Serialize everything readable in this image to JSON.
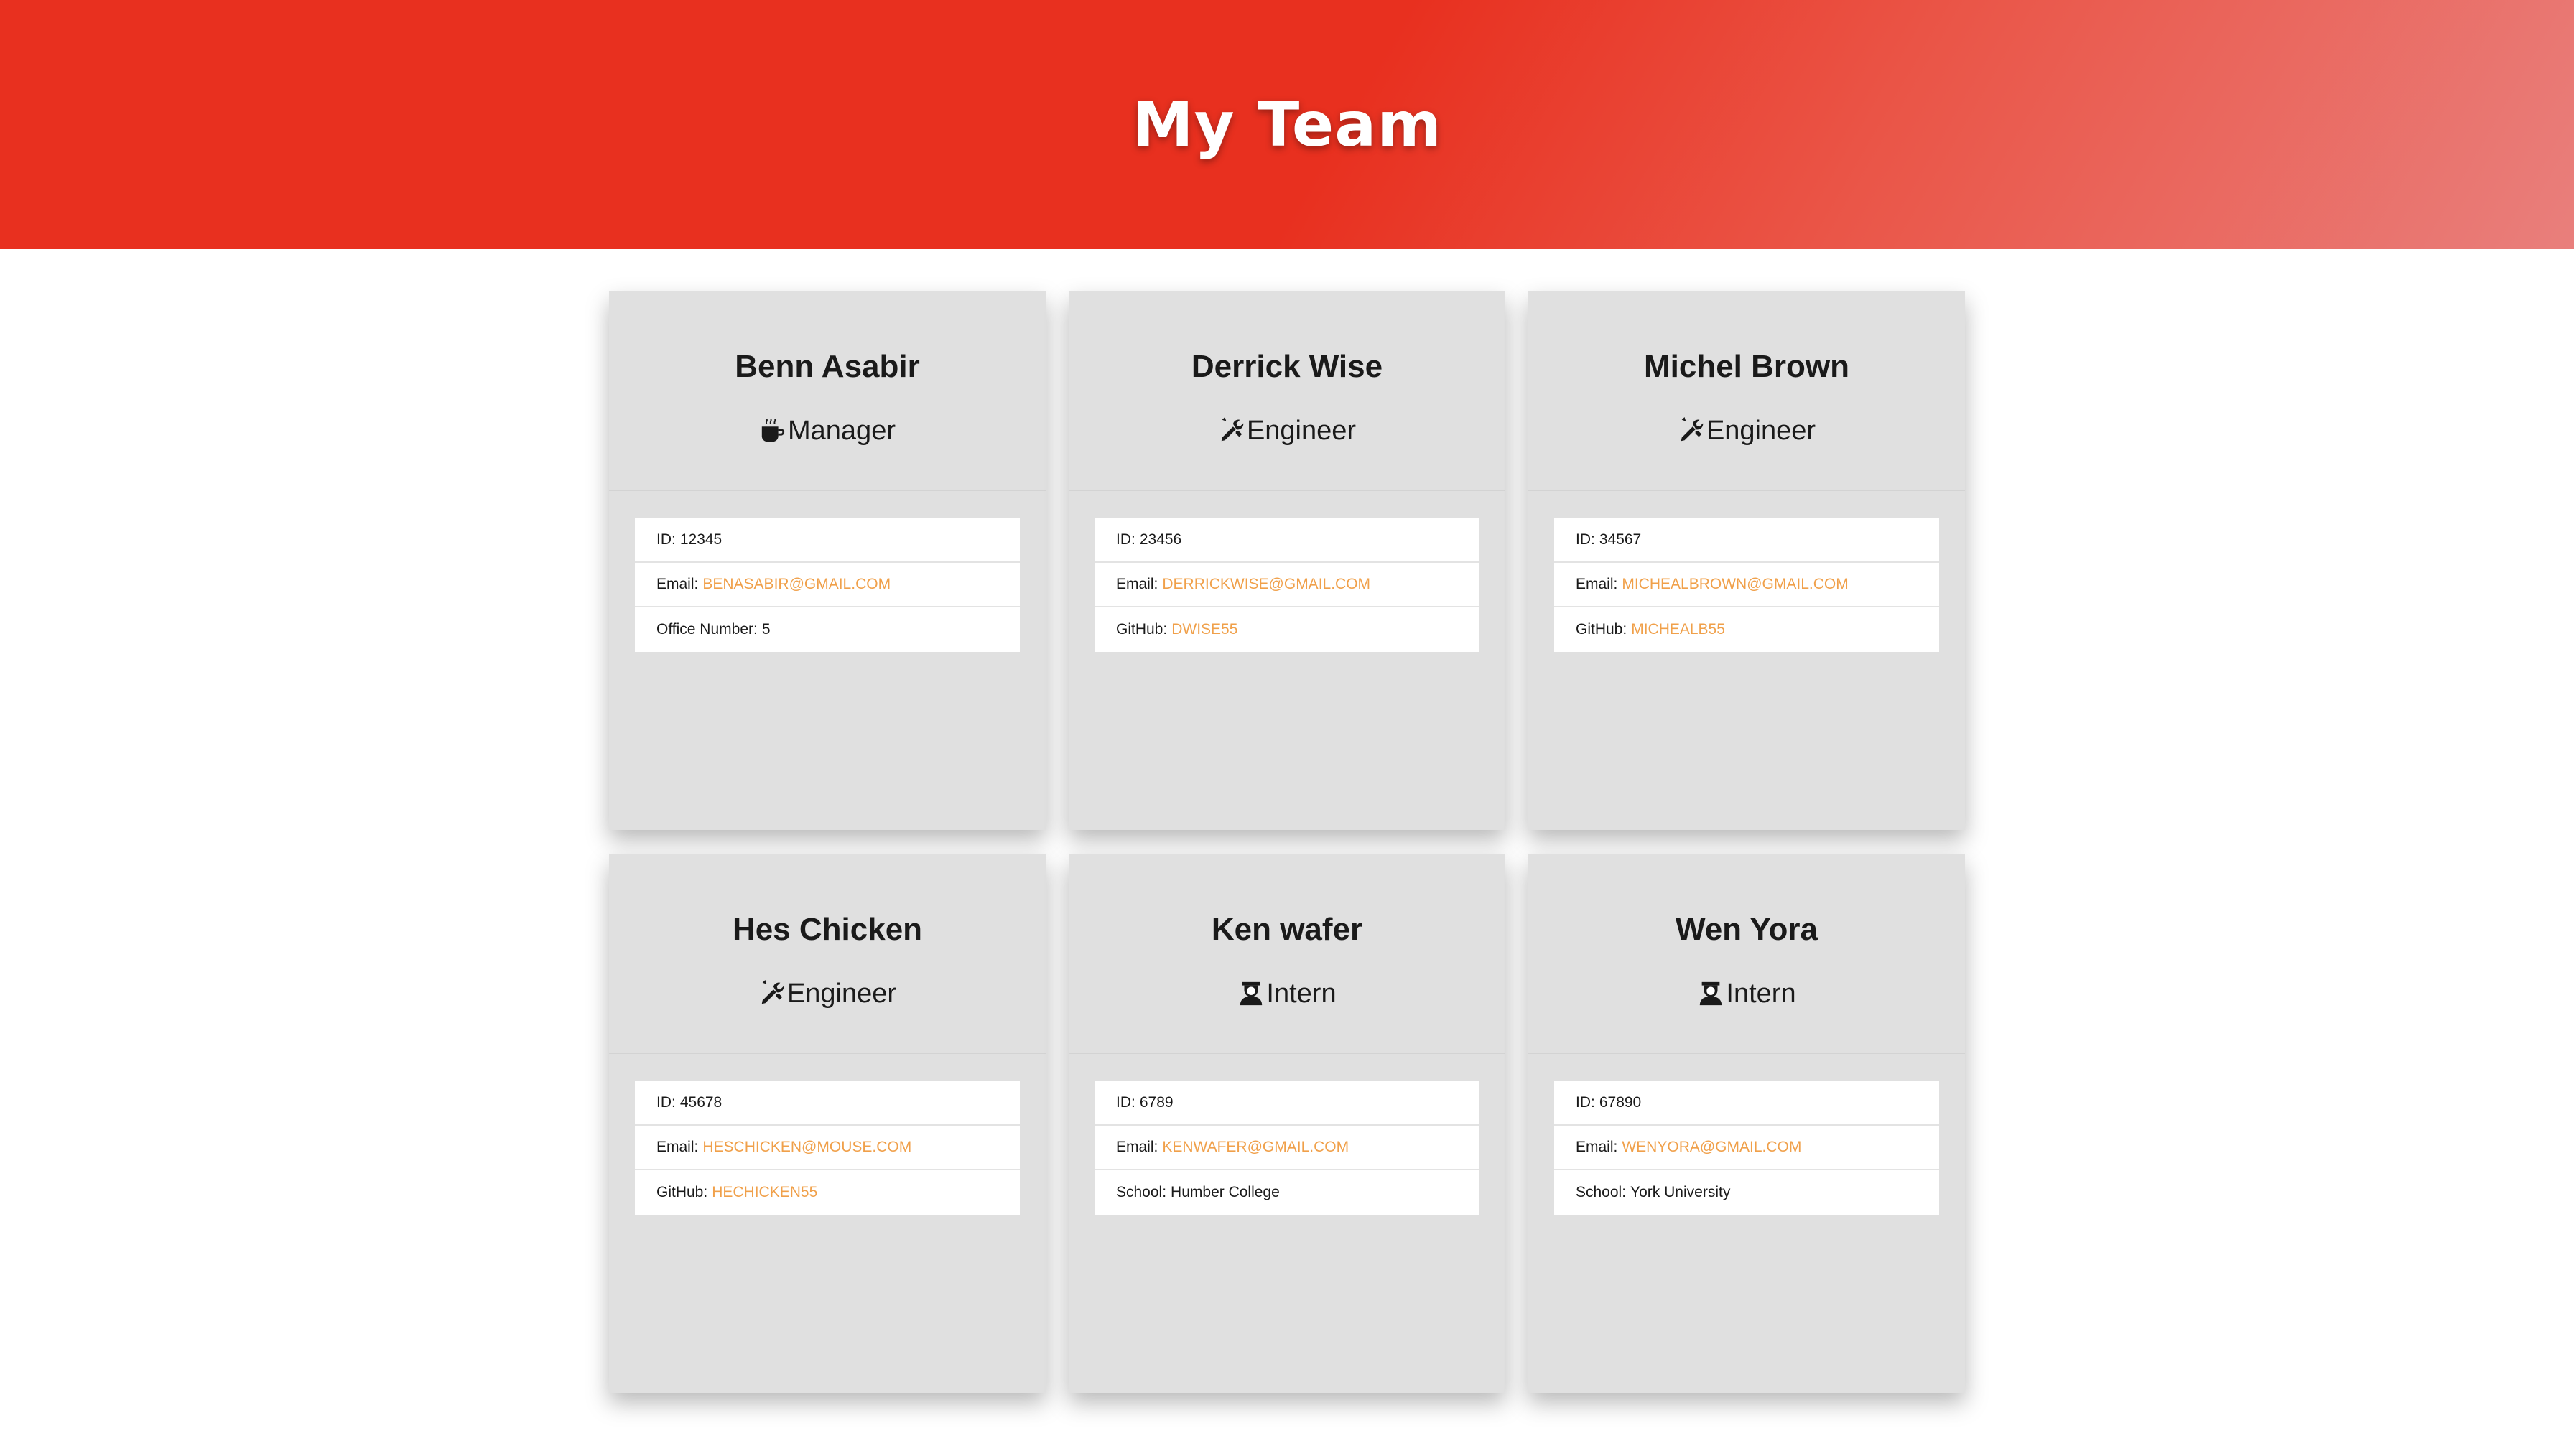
{
  "header": {
    "title": "My Team"
  },
  "colors": {
    "header_red": "#e8301f",
    "link_orange": "#f0a04a",
    "card_bg": "#e0e0e0"
  },
  "cards": [
    {
      "name": "Benn Asabir",
      "role": "Manager",
      "role_icon": "mug-icon",
      "rows": [
        {
          "label": "ID:",
          "value": "12345"
        },
        {
          "label": "Email:",
          "value": "benasabir@gmail.com"
        },
        {
          "label": "Office Number:",
          "value": "5"
        }
      ]
    },
    {
      "name": "Derrick Wise",
      "role": "Engineer",
      "role_icon": "tools-icon",
      "rows": [
        {
          "label": "ID:",
          "value": "23456"
        },
        {
          "label": "Email:",
          "value": "derrickwise@gmail.com"
        },
        {
          "label": "GitHub:",
          "value": "dwise55"
        }
      ]
    },
    {
      "name": "Michel Brown",
      "role": "Engineer",
      "role_icon": "tools-icon",
      "rows": [
        {
          "label": "ID:",
          "value": "34567"
        },
        {
          "label": "Email:",
          "value": "michealbrown@gmail.com"
        },
        {
          "label": "GitHub:",
          "value": "michealb55"
        }
      ]
    },
    {
      "name": "Hes Chicken",
      "role": "Engineer",
      "role_icon": "tools-icon",
      "rows": [
        {
          "label": "ID:",
          "value": "45678"
        },
        {
          "label": "Email:",
          "value": "heschicken@mouse.com"
        },
        {
          "label": "GitHub:",
          "value": "hechicken55"
        }
      ]
    },
    {
      "name": "Ken wafer",
      "role": "Intern",
      "role_icon": "graduate-icon",
      "rows": [
        {
          "label": "ID:",
          "value": "6789"
        },
        {
          "label": "Email:",
          "value": "kenwafer@gmail.com"
        },
        {
          "label": "School:",
          "value": "Humber College"
        }
      ]
    },
    {
      "name": "Wen Yora",
      "role": "Intern",
      "role_icon": "graduate-icon",
      "rows": [
        {
          "label": "ID:",
          "value": "67890"
        },
        {
          "label": "Email:",
          "value": "wenyora@gmail.com"
        },
        {
          "label": "School:",
          "value": "York University"
        }
      ]
    }
  ]
}
